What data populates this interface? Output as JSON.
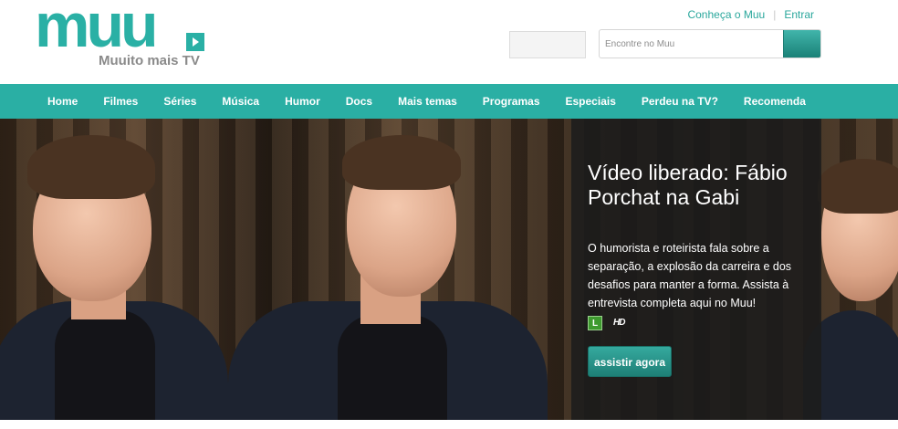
{
  "brand": {
    "logo_text": "muu",
    "tagline": "Muuito mais TV",
    "accent_color": "#2aafa4"
  },
  "top_links": [
    {
      "label": "Conheça o Muu"
    },
    {
      "label": "Entrar"
    }
  ],
  "search": {
    "placeholder": "Encontre no Muu",
    "button_icon": "search-icon"
  },
  "nav": {
    "items": [
      {
        "label": "Home"
      },
      {
        "label": "Filmes"
      },
      {
        "label": "Séries"
      },
      {
        "label": "Música"
      },
      {
        "label": "Humor"
      },
      {
        "label": "Docs"
      },
      {
        "label": "Mais temas"
      },
      {
        "label": "Programas"
      },
      {
        "label": "Especiais"
      },
      {
        "label": "Perdeu na TV?"
      },
      {
        "label": "Recomenda"
      }
    ]
  },
  "hero": {
    "title": "Vídeo liberado: Fábio Porchat na Gabi",
    "description": "O humorista e roteirista fala sobre a separação, a explosão da carreira e dos desafios para manter a forma. Assista à entrevista completa aqui no Muu!",
    "rating": "L",
    "quality_badge": "HD",
    "cta_label": "assistir agora"
  }
}
